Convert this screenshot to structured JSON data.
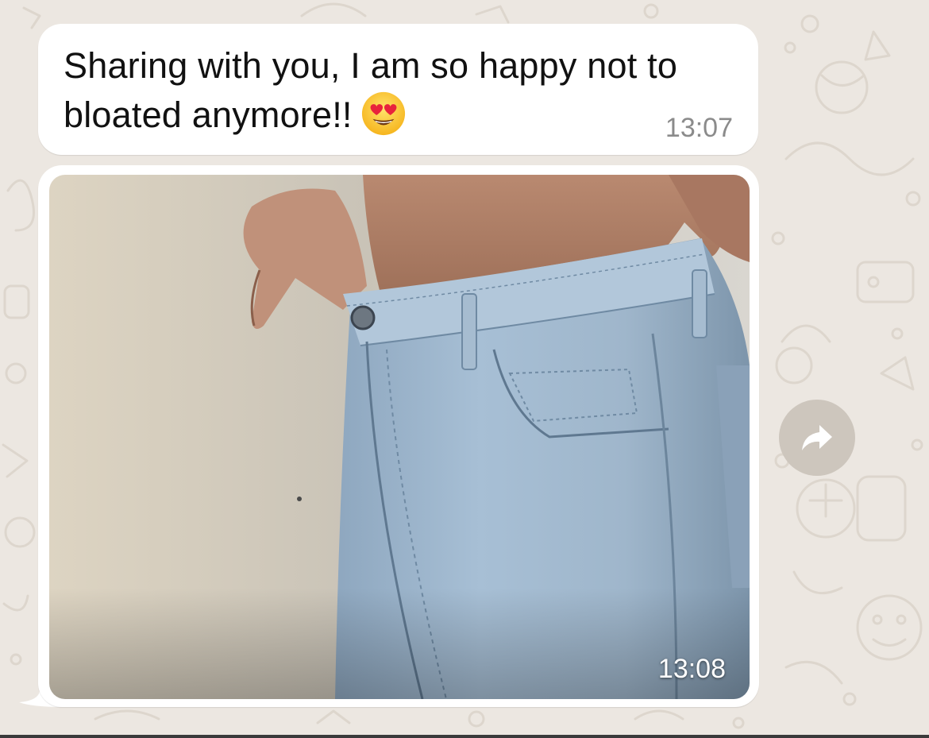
{
  "messages": [
    {
      "type": "text",
      "text": "Sharing with you, I am so happy not to bloated anymore!!",
      "emoji": "smiling-face-with-heart-eyes-icon",
      "time": "13:07"
    },
    {
      "type": "image",
      "image_subject": "light blue jeans",
      "time": "13:08"
    }
  ],
  "forward_button": {
    "icon": "forward-arrow-icon"
  },
  "colors": {
    "chat_background": "#ece7e1",
    "bubble": "#ffffff",
    "timestamp": "#8b8b8b",
    "forward_button": "#cdc6bd"
  }
}
